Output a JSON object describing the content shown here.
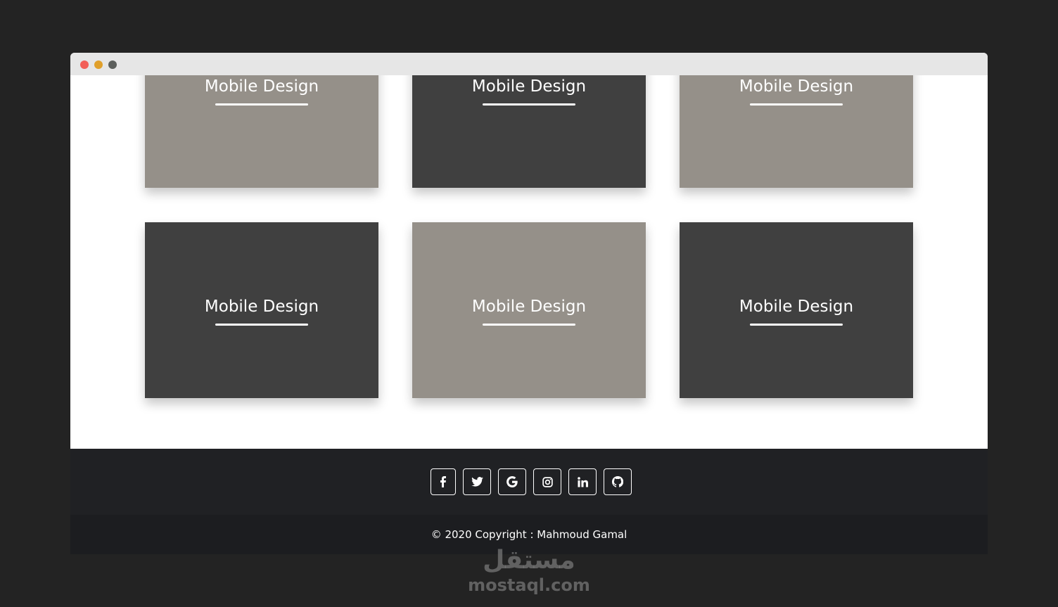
{
  "colors": {
    "page_bg": "#232323",
    "titlebar_bg": "#e6e6e6",
    "dot_red": "#f25f58",
    "dot_yellow": "#e0a02b",
    "dot_gray": "#5c5f5c",
    "card_light": "#959089",
    "card_dark": "#404040",
    "footer_top_bg": "#202124",
    "footer_bottom_bg": "#1c1d20"
  },
  "cards": [
    {
      "title": "Mobile Design",
      "tone": "light"
    },
    {
      "title": "Mobile Design",
      "tone": "dark"
    },
    {
      "title": "Mobile Design",
      "tone": "light"
    },
    {
      "title": "Mobile Design",
      "tone": "dark"
    },
    {
      "title": "Mobile Design",
      "tone": "light"
    },
    {
      "title": "Mobile Design",
      "tone": "dark"
    }
  ],
  "social": [
    {
      "icon": "facebook-icon"
    },
    {
      "icon": "twitter-icon"
    },
    {
      "icon": "google-icon"
    },
    {
      "icon": "instagram-icon"
    },
    {
      "icon": "linkedin-icon"
    },
    {
      "icon": "github-icon"
    }
  ],
  "footer": {
    "copyright": "© 2020 Copyright : Mahmoud Gamal"
  },
  "watermark": {
    "arabic": "مستقل",
    "latin": "mostaql.com"
  }
}
